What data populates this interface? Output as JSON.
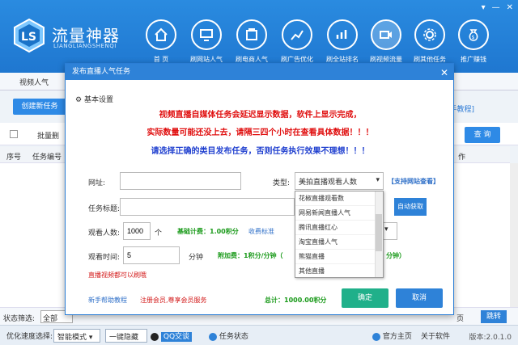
{
  "header": {
    "title": "流量神器",
    "subtitle": "LIANGLIANGSHENQI",
    "nav": [
      {
        "label": "首 页",
        "icon": "home-icon"
      },
      {
        "label": "刷网站人气",
        "icon": "monitor-icon"
      },
      {
        "label": "刷电商人气",
        "icon": "store-icon"
      },
      {
        "label": "刷广告优化",
        "icon": "chart-icon"
      },
      {
        "label": "刷全站排名",
        "icon": "trend-icon"
      },
      {
        "label": "刷视频流量",
        "icon": "video-icon"
      },
      {
        "label": "刷其他任务",
        "icon": "gear-icon"
      },
      {
        "label": "推广赚钱",
        "icon": "moneybag-icon"
      }
    ]
  },
  "main": {
    "tab_label": "视频人气",
    "create_button": "创建新任务",
    "batch_label": "批量删",
    "help_link": "手教程]",
    "search_button": "查 询",
    "columns": [
      "序号",
      "任务编号",
      "作"
    ],
    "status_label": "状态筛选:",
    "status_value": "全部",
    "right_btn_a": "页",
    "right_btn_b": "跳转"
  },
  "bottom": {
    "speed_label": "优化速度选择:",
    "speed_value": "智能模式",
    "hide_btn": "一键隐藏",
    "qq_label": "QQ交谈",
    "task_status": "任务状态",
    "home_link": "官方主页",
    "about_link": "关于软件",
    "version": "版本:2.0.1.0"
  },
  "dialog": {
    "title": "发布直播人气任务",
    "section": "基本设置",
    "notice1": "视频直播自媒体任务会延迟显示数据，软件上显示完成，",
    "notice2": "实际数量可能还没上去，请隔三四个小时在查看具体数据！！！",
    "notice3": "请选择正确的类目发布任务，否则任务执行效果不理想！！！",
    "url_label": "网址:",
    "url_value": "",
    "type_label": "类型:",
    "type_value": "美拍直播观看人数",
    "support_link": "【支持网站查看】",
    "task_title_label": "任务标题:",
    "auto_fetch": "自动获取",
    "viewers_label": "观看人数:",
    "viewers_value": "1000",
    "viewers_unit": "个",
    "base_fee": "基础计费：1.00积分",
    "fee_standard": "收费标准",
    "time_label": "观看时间:",
    "time_value": "5",
    "time_unit": "分钟",
    "extra_fee": "附加费：1积分/分钟（",
    "extra_fee_tail": "分钟）",
    "warn": "直播视频都可以刷哦",
    "help": "新手帮助教程",
    "vip": "注册会员,尊享会员服务",
    "total": "总计：1000.00积分",
    "ok": "确定",
    "cancel": "取消",
    "type_options": [
      "花椒直播观看数",
      "网易新闻直播人气",
      "腾讯直播红心",
      "淘宝直播人气",
      "熊猫直播",
      "其他直播"
    ]
  }
}
